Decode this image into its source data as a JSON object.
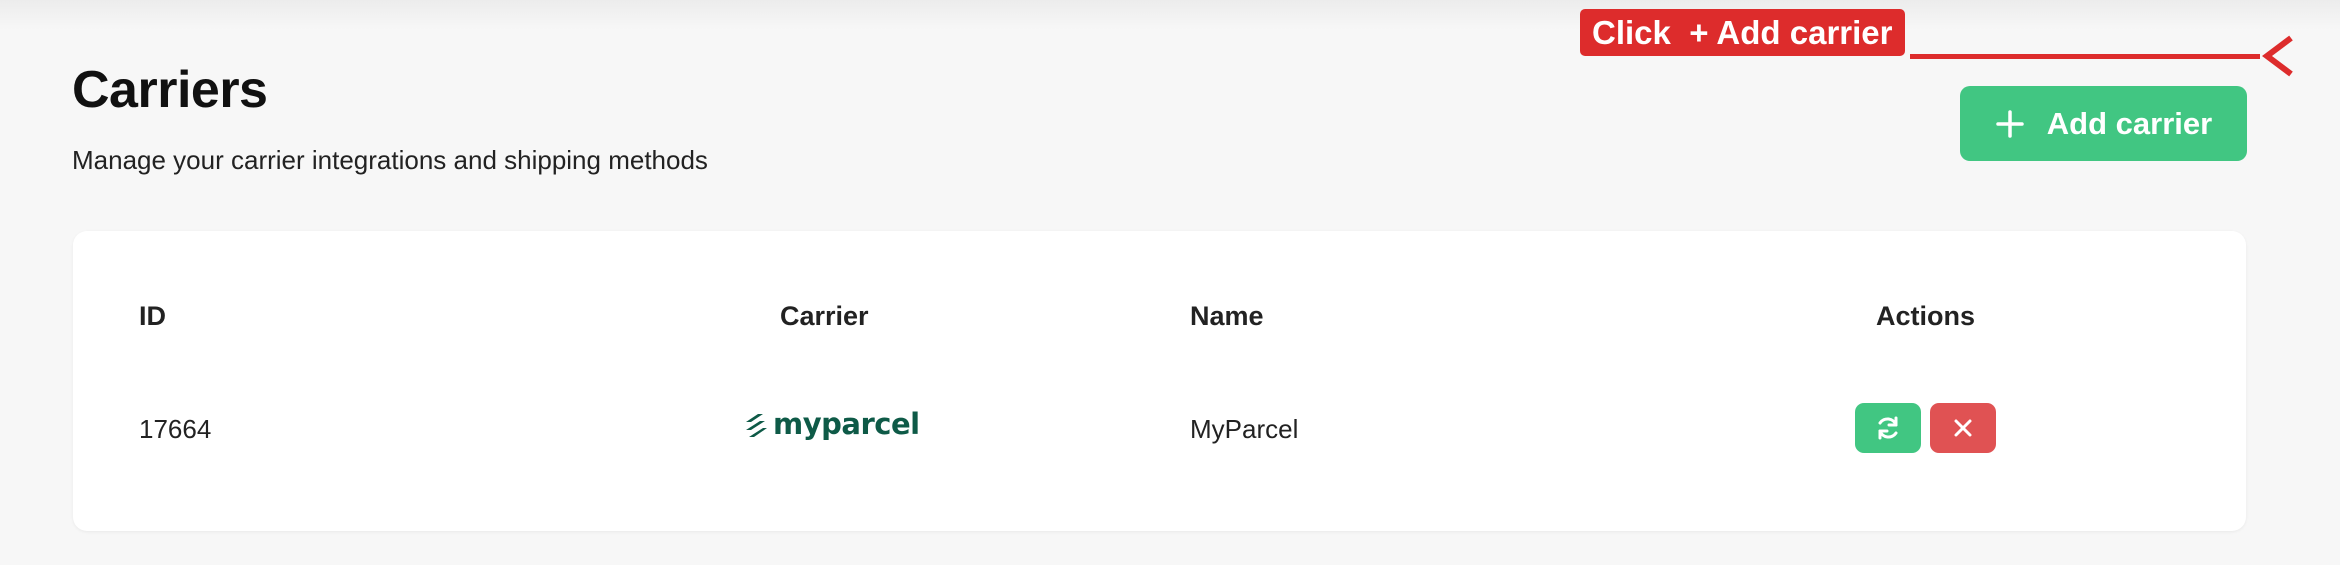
{
  "header": {
    "title": "Carriers",
    "subtitle": "Manage your carrier integrations and shipping methods",
    "add_button_label": "Add carrier",
    "add_button_icon": "plus-icon"
  },
  "annotation": {
    "label": "Click  + Add carrier",
    "color": "#dd2c2c"
  },
  "table": {
    "columns": [
      "ID",
      "Carrier",
      "Name",
      "Actions"
    ],
    "rows": [
      {
        "id": "17664",
        "carrier_logo": "myparcel",
        "carrier_logo_icon": "myparcel-logo-icon",
        "name": "MyParcel",
        "actions": [
          "refresh-icon",
          "close-icon"
        ]
      }
    ]
  },
  "colors": {
    "accent_green": "#41c682",
    "danger_red": "#e05253",
    "background": "#f7f7f7",
    "brand_myparcel": "#0e5a47"
  }
}
